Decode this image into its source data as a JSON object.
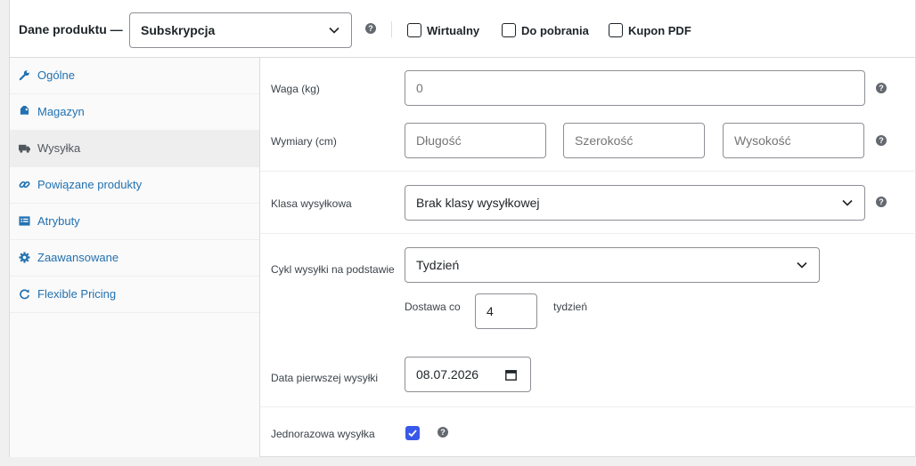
{
  "header": {
    "title": "Dane produktu —",
    "product_type": "Subskrypcja",
    "options": [
      {
        "label": "Wirtualny",
        "checked": false
      },
      {
        "label": "Do pobrania",
        "checked": false
      },
      {
        "label": "Kupon PDF",
        "checked": false
      }
    ]
  },
  "sidebar": {
    "items": [
      {
        "label": "Ogólne",
        "icon": "wrench-icon"
      },
      {
        "label": "Magazyn",
        "icon": "tag-icon"
      },
      {
        "label": "Wysyłka",
        "icon": "truck-icon",
        "active": true
      },
      {
        "label": "Powiązane produkty",
        "icon": "link-icon"
      },
      {
        "label": "Atrybuty",
        "icon": "list-icon"
      },
      {
        "label": "Zaawansowane",
        "icon": "gear-icon"
      },
      {
        "label": "Flexible Pricing",
        "icon": "refresh-icon"
      }
    ]
  },
  "shipping": {
    "weight_label": "Waga (kg)",
    "weight_placeholder": "0",
    "dimensions_label": "Wymiary (cm)",
    "length_placeholder": "Długość",
    "width_placeholder": "Szerokość",
    "height_placeholder": "Wysokość",
    "class_label": "Klasa wysyłkowa",
    "class_value": "Brak klasy wysyłkowej",
    "cycle_label": "Cykl wysyłki na podstawie",
    "cycle_value": "Tydzień",
    "delivery_every_label": "Dostawa co",
    "delivery_every_value": "4",
    "delivery_unit": "tydzień",
    "first_date_label": "Data pierwszej wysyłki",
    "first_date_value": "08.07.2026",
    "one_time_label": "Jednorazowa wysyłka",
    "one_time_checked": true
  },
  "colors": {
    "link": "#2271b1",
    "checkbox_accent": "#3858e9"
  }
}
